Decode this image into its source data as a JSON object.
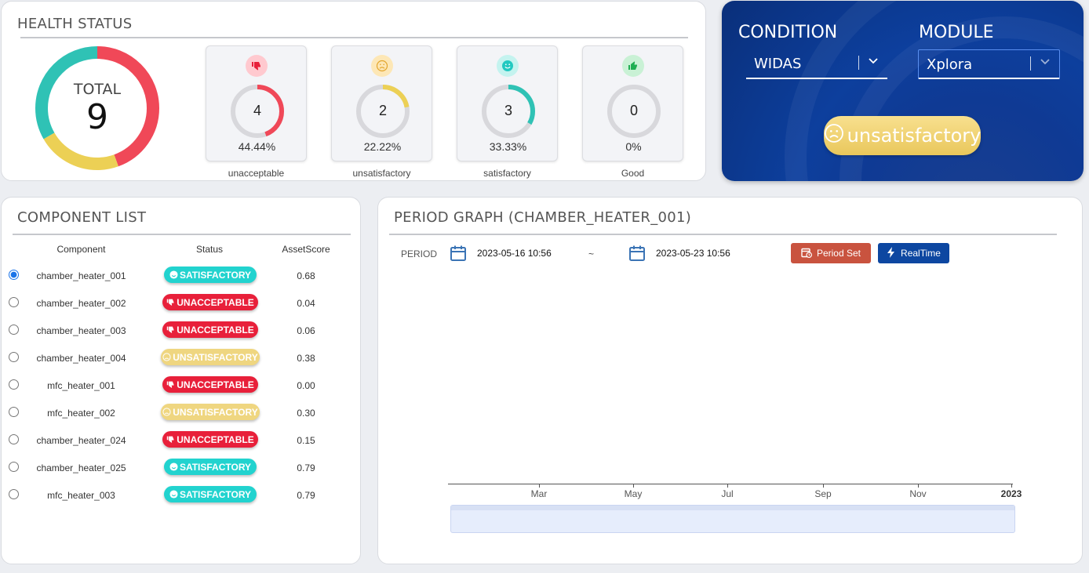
{
  "health": {
    "title": "HEALTH STATUS",
    "total_label": "TOTAL",
    "total_value": "9",
    "stats": [
      {
        "count": "4",
        "pct": "44.44%",
        "label": "unacceptable",
        "fraction": 0.4444,
        "color": "#f04858",
        "icon": "thumbs-down-icon"
      },
      {
        "count": "2",
        "pct": "22.22%",
        "label": "unsatisfactory",
        "fraction": 0.2222,
        "color": "#ecd055",
        "icon": "sad-face-icon"
      },
      {
        "count": "3",
        "pct": "33.33%",
        "label": "satisfactory",
        "fraction": 0.3333,
        "color": "#2fc2b5",
        "icon": "smile-face-icon"
      },
      {
        "count": "0",
        "pct": "0%",
        "label": "Good",
        "fraction": 0,
        "color": "#2ebd63",
        "icon": "thumbs-up-icon"
      }
    ]
  },
  "condition": {
    "condition_label": "CONDITION",
    "module_label": "MODULE",
    "condition_value": "WIDAS",
    "module_value": "Xplora",
    "result": "unsatisfactory"
  },
  "components": {
    "title": "COMPONENT LIST",
    "headers": {
      "component": "Component",
      "status": "Status",
      "score": "AssetScore"
    },
    "rows": [
      {
        "name": "chamber_heater_001",
        "status": "SATISFACTORY",
        "score": "0.68",
        "selected": true
      },
      {
        "name": "chamber_heater_002",
        "status": "UNACCEPTABLE",
        "score": "0.04",
        "selected": false
      },
      {
        "name": "chamber_heater_003",
        "status": "UNACCEPTABLE",
        "score": "0.06",
        "selected": false
      },
      {
        "name": "chamber_heater_004",
        "status": "UNSATISFACTORY",
        "score": "0.38",
        "selected": false
      },
      {
        "name": "mfc_heater_001",
        "status": "UNACCEPTABLE",
        "score": "0.00",
        "selected": false
      },
      {
        "name": "mfc_heater_002",
        "status": "UNSATISFACTORY",
        "score": "0.30",
        "selected": false
      },
      {
        "name": "chamber_heater_024",
        "status": "UNACCEPTABLE",
        "score": "0.15",
        "selected": false
      },
      {
        "name": "chamber_heater_025",
        "status": "SATISFACTORY",
        "score": "0.79",
        "selected": false
      },
      {
        "name": "mfc_heater_003",
        "status": "SATISFACTORY",
        "score": "0.79",
        "selected": false
      }
    ]
  },
  "period": {
    "title": "PERIOD GRAPH (CHAMBER_HEATER_001)",
    "period_label": "PERIOD",
    "start": "2023-05-16 10:56",
    "tilde": "~",
    "end": "2023-05-23 10:56",
    "period_set_label": "Period Set",
    "realtime_label": "RealTime",
    "axis_ticks": [
      "Mar",
      "May",
      "Jul",
      "Sep",
      "Nov",
      "2023"
    ]
  },
  "colors": {
    "unacceptable": "#e8203a",
    "unsatisfactory": "#efd680",
    "satisfactory": "#22d3cf",
    "period_set": "#c9533f",
    "realtime": "#0d47a1"
  }
}
